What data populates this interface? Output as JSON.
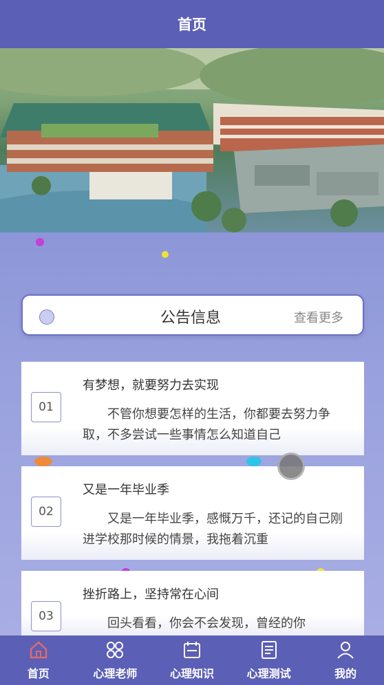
{
  "header": {
    "title": "首页"
  },
  "notice": {
    "title": "公告信息",
    "more": "查看更多"
  },
  "cards": [
    {
      "num": "01",
      "title": "有梦想，就要努力去实现",
      "body": "不管你想要怎样的生活，你都要去努力争取，不多尝试一些事情怎么知道自己"
    },
    {
      "num": "02",
      "title": "又是一年毕业季",
      "body": "又是一年毕业季，感慨万千，还记的自己刚进学校那时候的情景，我拖着沉重"
    },
    {
      "num": "03",
      "title": "挫折路上，坚持常在心间",
      "body": "回头看看，你会不会发现，曾经的你"
    }
  ],
  "tabs": [
    {
      "label": "首页",
      "icon": "home-icon"
    },
    {
      "label": "心理老师",
      "icon": "teacher-icon"
    },
    {
      "label": "心理知识",
      "icon": "knowledge-icon"
    },
    {
      "label": "心理测试",
      "icon": "test-icon"
    },
    {
      "label": "我的",
      "icon": "user-icon"
    }
  ],
  "colors": {
    "primary": "#5b5fb5",
    "background": "#8f97d8",
    "active_tab": "#e06a6a"
  }
}
